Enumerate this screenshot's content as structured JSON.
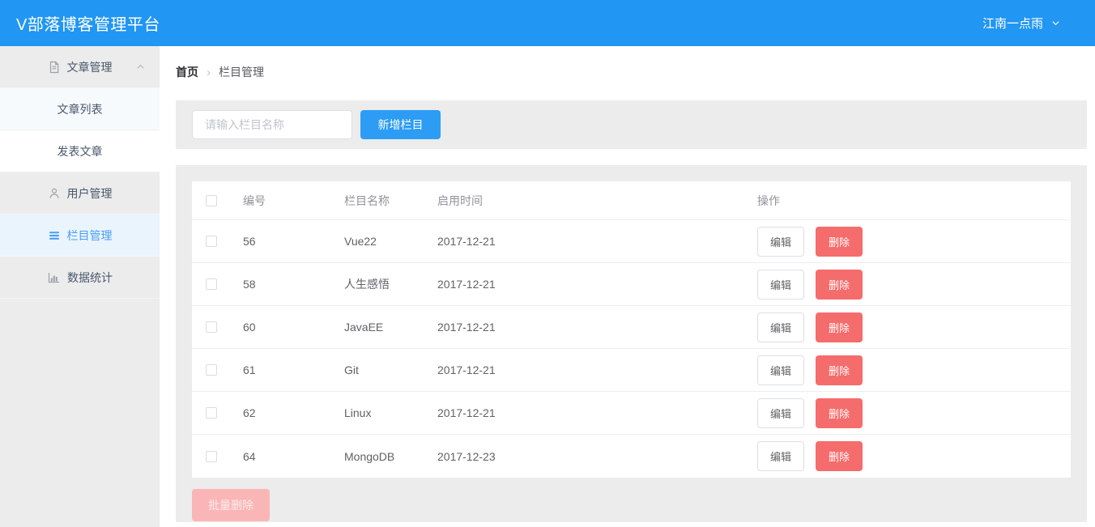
{
  "header": {
    "title": "V部落博客管理平台",
    "user_name": "江南一点雨",
    "user_dropdown_icon": "chevron-down-icon"
  },
  "sidebar": {
    "items": [
      {
        "label": "文章管理",
        "icon": "document-icon",
        "caret_icon": "chevron-up-icon",
        "type": "group",
        "expanded": true
      },
      {
        "label": "文章列表",
        "type": "submenu-item"
      },
      {
        "label": "发表文章",
        "type": "submenu-item"
      },
      {
        "label": "用户管理",
        "icon": "user-icon",
        "type": "item"
      },
      {
        "label": "栏目管理",
        "icon": "list-icon",
        "type": "item",
        "active": true
      },
      {
        "label": "数据统计",
        "icon": "bar-chart-icon",
        "type": "item"
      }
    ]
  },
  "breadcrumb": {
    "home": "首页",
    "separator": "›",
    "current": "栏目管理"
  },
  "toolbar": {
    "search_placeholder": "请输入栏目名称",
    "search_value": "",
    "add_button_label": "新增栏目"
  },
  "table": {
    "columns": {
      "id": "编号",
      "name": "栏目名称",
      "date": "启用时间",
      "actions": "操作"
    },
    "rows": [
      {
        "id": "56",
        "name": "Vue22",
        "date": "2017-12-21"
      },
      {
        "id": "58",
        "name": "人生感悟",
        "date": "2017-12-21"
      },
      {
        "id": "60",
        "name": "JavaEE",
        "date": "2017-12-21"
      },
      {
        "id": "61",
        "name": "Git",
        "date": "2017-12-21"
      },
      {
        "id": "62",
        "name": "Linux",
        "date": "2017-12-21"
      },
      {
        "id": "64",
        "name": "MongoDB",
        "date": "2017-12-23"
      }
    ],
    "edit_label": "编辑",
    "delete_label": "删除",
    "batch_delete_label": "批量删除",
    "all_checkboxes_unchecked": true
  },
  "colors": {
    "header_blue": "#2196f3",
    "primary_button_blue": "#2d9cf4",
    "danger_red": "#f56c6c",
    "danger_disabled_pink": "#fab6b6",
    "active_menu_blue": "#4a9ef9",
    "section_gray": "#ececec"
  }
}
